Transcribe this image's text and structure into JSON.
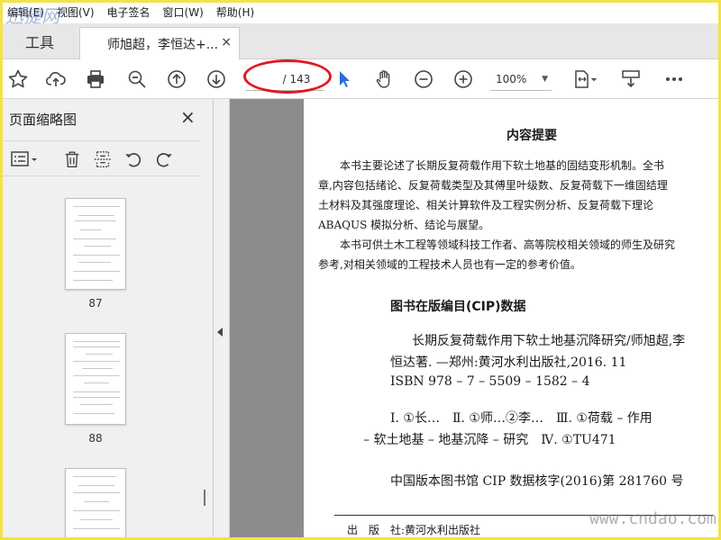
{
  "watermark_top": "迅捷网",
  "menu": [
    "编辑(E)",
    "视图(V)",
    "电子签名",
    "窗口(W)",
    "帮助(H)"
  ],
  "tabs": {
    "tools_label": "工具",
    "doc_label": "师旭超，李恒达+...",
    "close": "×"
  },
  "toolbar": {
    "page_current": "",
    "page_total": "/ 143",
    "zoom": "100%",
    "icons": [
      "star-icon",
      "upload-cloud-icon",
      "print-icon",
      "zoom-out-magnifier-icon",
      "page-up-icon",
      "page-down-icon",
      "select-arrow-icon",
      "hand-icon",
      "zoom-out-icon",
      "zoom-in-icon",
      "fit-page-icon",
      "scroll-mode-icon",
      "more-icon"
    ]
  },
  "sidebar": {
    "title": "页面缩略图",
    "close": "×",
    "thumbnails": [
      {
        "label": "87"
      },
      {
        "label": "88"
      },
      {
        "label": ""
      }
    ]
  },
  "document": {
    "heading": "内容提要",
    "paragraphs": [
      "　　本书主要论述了长期反复荷载作用下软土地基的固结变形机制。全书",
      "章,内容包括绪论、反复荷载类型及其傅里叶级数、反复荷载下一维固结理",
      "土材料及其强度理论、相关计算软件及工程实例分析、反复荷载下理论",
      "ABAQUS 模拟分析、结论与展望。",
      "　　本书可供土木工程等领域科技工作者、高等院校相关领域的师生及研究",
      "参考,对相关领域的工程技术人员也有一定的参考价值。"
    ],
    "cip_title": "图书在版编目(CIP)数据",
    "cip_lines": [
      "长期反复荷载作用下软土地基沉降研究/师旭超,李",
      "恒达著. —郑州:黄河水利出版社,2016. 11",
      "ISBN 978 – 7 – 5509 – 1582 – 4",
      "Ⅰ. ①长…　Ⅱ. ①师…②李…　Ⅲ. ①荷载 – 作用",
      "– 软土地基 – 地基沉降 – 研究　Ⅳ. ①TU471",
      "中国版本图书馆 CIP 数据核字(2016)第 281760 号"
    ],
    "footer": "出　版　社:黄河水利出版社"
  },
  "watermark_bottom": "www.cndao.com"
}
